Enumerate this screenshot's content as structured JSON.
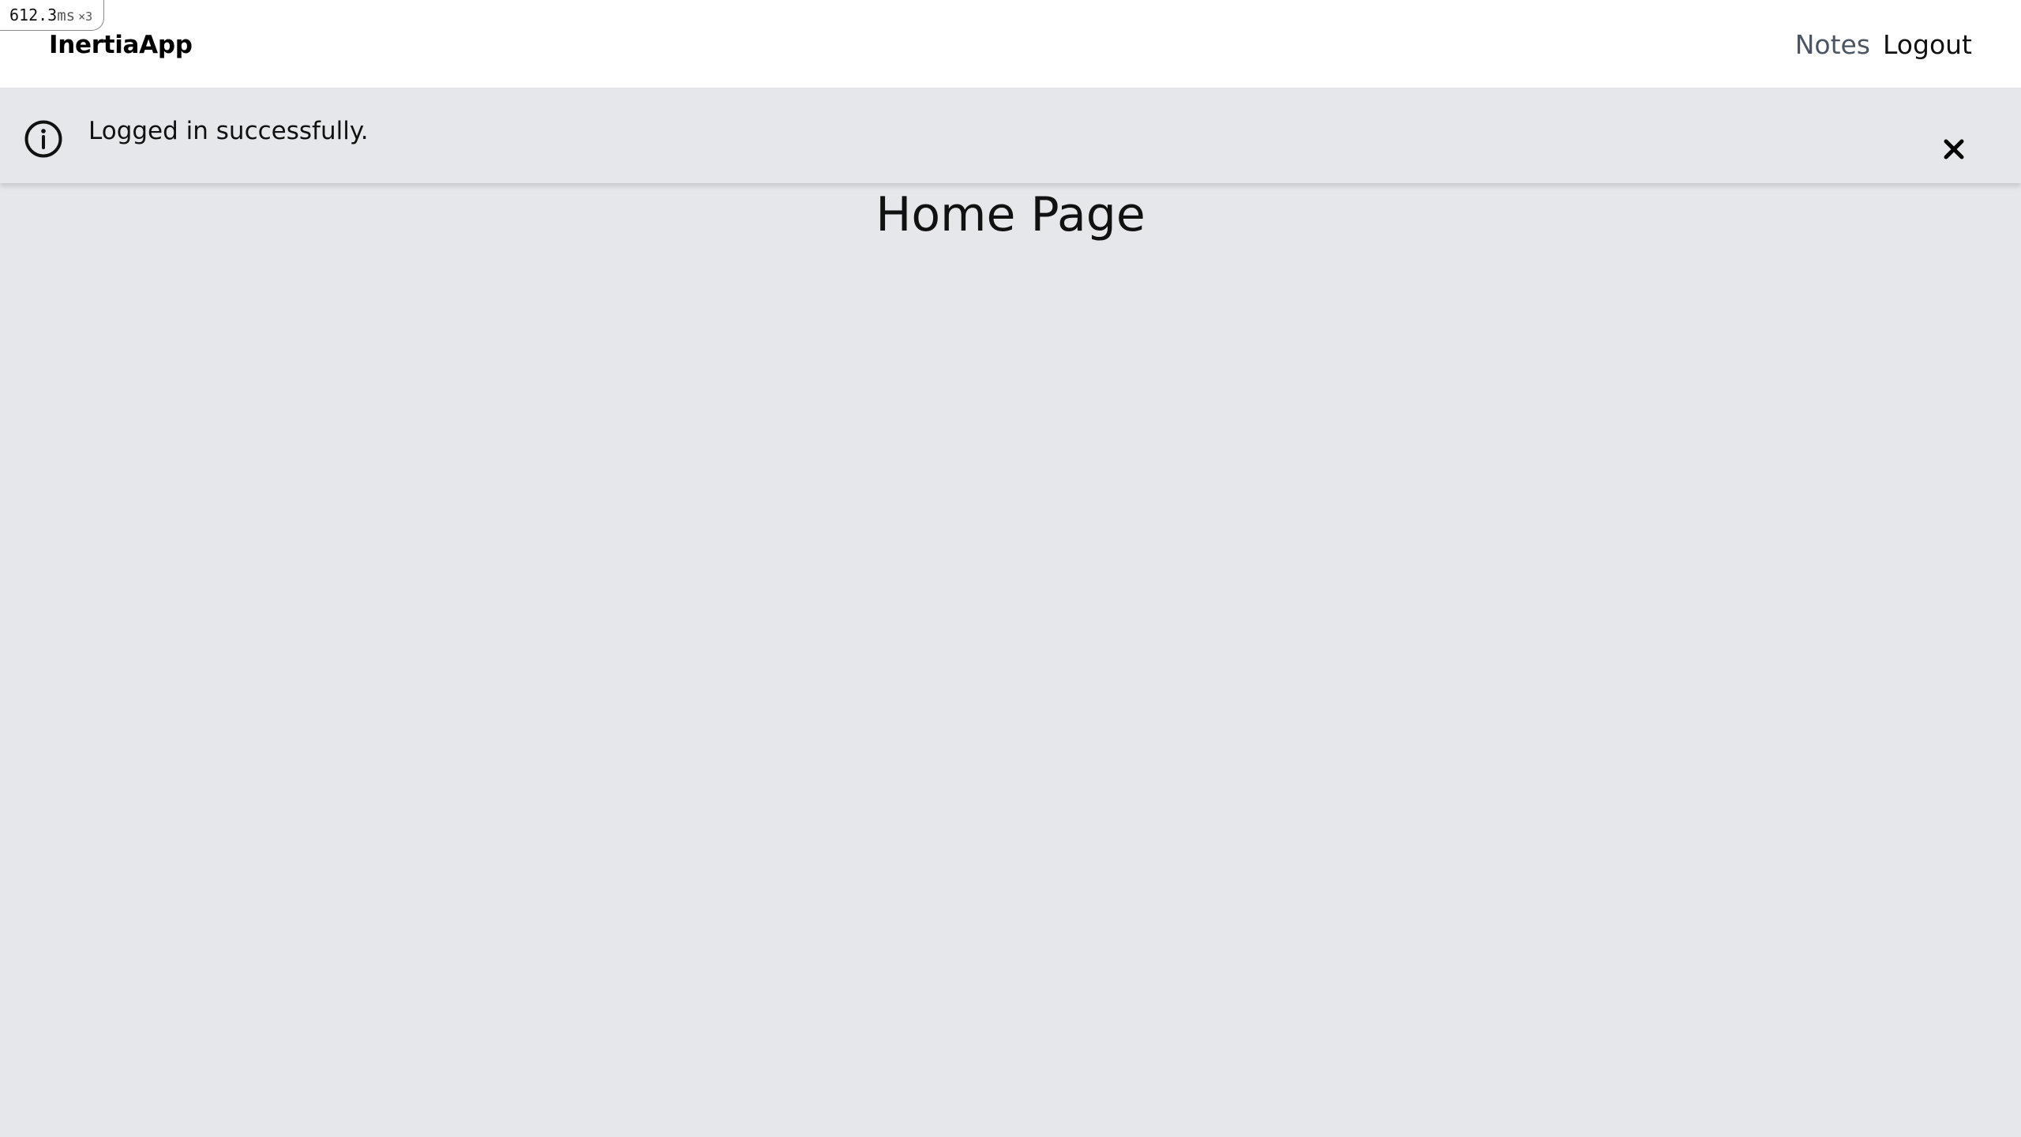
{
  "perf_badge": {
    "value": "612.3",
    "unit": "ms",
    "count": "×3"
  },
  "navbar": {
    "brand": "InertiaApp",
    "links": [
      {
        "label": "Notes"
      },
      {
        "label": "Logout"
      }
    ]
  },
  "flash": {
    "icon": "info-icon",
    "message": "Logged in successfully.",
    "close_icon": "close-icon"
  },
  "main": {
    "title": "Home Page"
  },
  "colors": {
    "background": "#e5e7eb",
    "navbar_background": "#ffffff",
    "nav_link_muted": "#4b5563",
    "text": "#111111"
  }
}
